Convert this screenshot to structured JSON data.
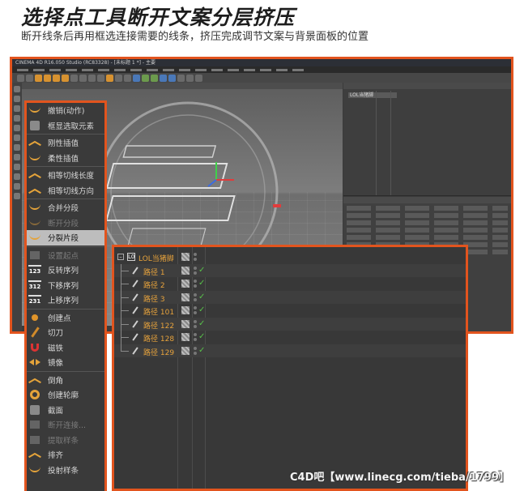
{
  "page": {
    "heading": "选择点工具断开文案分层挤压",
    "subheading": "断开线条后再用框选连接需要的线条，挤压完成调节文案与背景面板的位置"
  },
  "c4d_window": {
    "title": "CINEMA 4D R16.050 Studio (RC83328) - [未标题 1 *] - 主要",
    "accent": "#e2541e",
    "object_panel_item": "LOL当猪脚"
  },
  "context_menu": {
    "items": [
      {
        "label": "撤销(动作)",
        "icon": "undo-icon",
        "state": "normal"
      },
      {
        "label": "框显选取元素",
        "icon": "frame-selection-icon",
        "state": "normal"
      },
      {
        "sep": true
      },
      {
        "label": "刚性插值",
        "icon": "hard-interpolation-icon",
        "state": "normal"
      },
      {
        "label": "柔性插值",
        "icon": "soft-interpolation-icon",
        "state": "normal"
      },
      {
        "sep": true
      },
      {
        "label": "相等切线长度",
        "icon": "equal-tangent-length-icon",
        "state": "normal"
      },
      {
        "label": "相等切线方向",
        "icon": "equal-tangent-direction-icon",
        "state": "normal"
      },
      {
        "sep": true
      },
      {
        "label": "合并分段",
        "icon": "join-segment-icon",
        "state": "normal"
      },
      {
        "label": "断开分段",
        "icon": "break-segment-icon",
        "state": "disabled"
      },
      {
        "label": "分裂片段",
        "icon": "explode-segments-icon",
        "state": "selected"
      },
      {
        "sep": true
      },
      {
        "label": "设置起点",
        "icon": "set-first-point-icon",
        "state": "disabled"
      },
      {
        "label": "反转序列",
        "icon": "reverse-sequence-icon",
        "state": "normal",
        "num": "123"
      },
      {
        "label": "下移序列",
        "icon": "move-down-sequence-icon",
        "state": "normal",
        "num": "312"
      },
      {
        "label": "上移序列",
        "icon": "move-up-sequence-icon",
        "state": "normal",
        "num": "231"
      },
      {
        "sep": true
      },
      {
        "label": "创建点",
        "icon": "create-point-icon",
        "state": "normal"
      },
      {
        "label": "切刀",
        "icon": "knife-icon",
        "state": "normal"
      },
      {
        "label": "磁铁",
        "icon": "magnet-icon",
        "state": "normal"
      },
      {
        "label": "镜像",
        "icon": "mirror-icon",
        "state": "normal"
      },
      {
        "sep": true
      },
      {
        "label": "倒角",
        "icon": "chamfer-icon",
        "state": "normal"
      },
      {
        "label": "创建轮廓",
        "icon": "create-outline-icon",
        "state": "normal"
      },
      {
        "label": "截面",
        "icon": "cross-section-icon",
        "state": "normal"
      },
      {
        "label": "断开连接...",
        "icon": "disconnect-icon",
        "state": "disabled"
      },
      {
        "label": "提取样条",
        "icon": "extract-spline-icon",
        "state": "disabled"
      },
      {
        "label": "排齐",
        "icon": "line-up-icon",
        "state": "normal"
      },
      {
        "label": "投射样条",
        "icon": "project-spline-icon",
        "state": "normal"
      }
    ]
  },
  "object_list": {
    "root": {
      "label": "LOL当猪脚",
      "icon_text": "L0"
    },
    "children": [
      "路径 1",
      "路径 2",
      "路径 3",
      "路径 101",
      "路径 122",
      "路径 128",
      "路径 129"
    ],
    "check_mark": "✓",
    "expander_glyph": "–"
  },
  "watermark": "C4D吧【www.linecg.com/tieba/1799】"
}
